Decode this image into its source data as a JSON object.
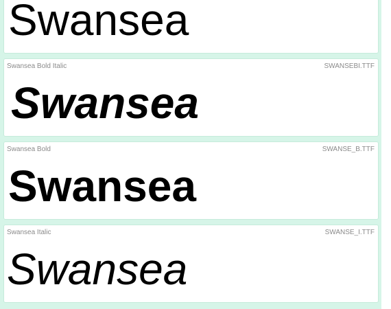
{
  "fonts": [
    {
      "name": "",
      "file": "",
      "sample": "Swansea"
    },
    {
      "name": "Swansea Bold Italic",
      "file": "SWANSEBI.TTF",
      "sample": "Swansea"
    },
    {
      "name": "Swansea Bold",
      "file": "SWANSE_B.TTF",
      "sample": "Swansea"
    },
    {
      "name": "Swansea Italic",
      "file": "SWANSE_I.TTF",
      "sample": "Swansea"
    }
  ]
}
